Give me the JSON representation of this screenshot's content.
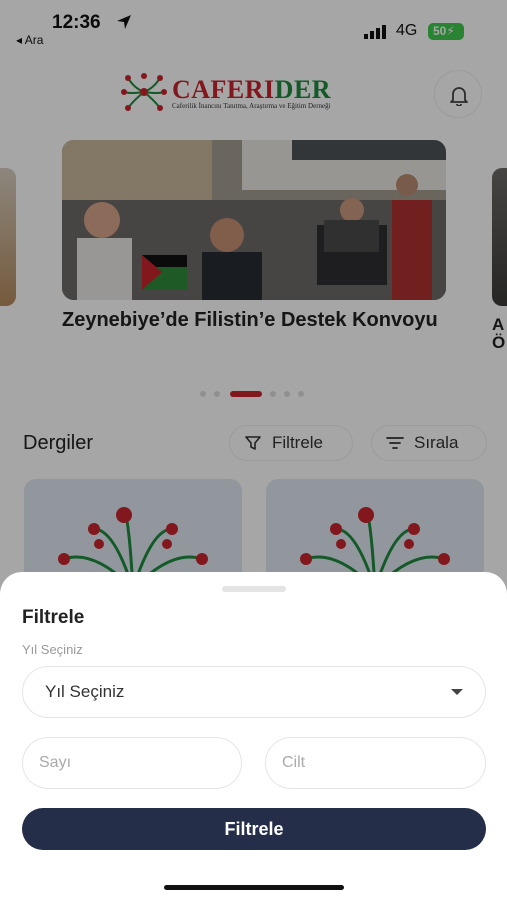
{
  "status_bar": {
    "time": "12:36",
    "back_label": "◂ Ara",
    "network": "4G",
    "battery": "50"
  },
  "header": {
    "logo_title_red": "CAFERI",
    "logo_title_green": "DER",
    "logo_subtitle": "Caferilik İnancını Tanıtma, Araştırma ve Eğitim Derneği"
  },
  "carousel": {
    "title": "Zeynebiye’de Filistin’e Destek Konvoyu",
    "next_title_partial": "A Ö",
    "dot_count": 6,
    "active_dot": 2
  },
  "section": {
    "title": "Dergiler",
    "filter_label": "Filtrele",
    "sort_label": "Sırala"
  },
  "sheet": {
    "title": "Filtrele",
    "year_label": "Yıl Seçiniz",
    "year_value": "Yıl Seçiniz",
    "number_placeholder": "Sayı",
    "volume_placeholder": "Cilt",
    "apply_label": "Filtrele"
  },
  "colors": {
    "brand_red": "#c8262d",
    "brand_green": "#1e8a3e",
    "primary_button": "#242e49"
  }
}
